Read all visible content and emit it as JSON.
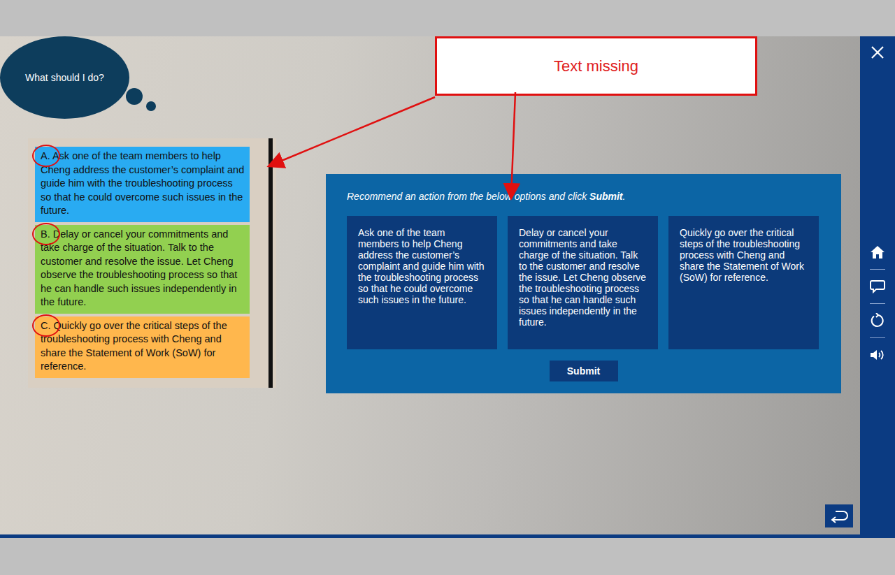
{
  "thought_bubble": {
    "text": "What should I do?"
  },
  "annotation_panel": {
    "options": [
      {
        "letter": "A.",
        "text": "Ask one of the team members  to help Cheng address the customer’s complaint and guide him with the troubleshooting process so that he could overcome such issues in the future.",
        "color": "#29abf2",
        "circled": true
      },
      {
        "letter": "B.",
        "text": "Delay or cancel your commitments and take charge of the situation. Talk to the customer and resolve the issue.  Let Cheng observe the troubleshooting process so that he can handle such issues independently in the future.",
        "color": "#92d050",
        "circled": true
      },
      {
        "letter": "C.",
        "text": "Quickly go over the critical steps of the troubleshooting process with Cheng and share the Statement of Work (SoW) for reference.",
        "color": "#ffb74d",
        "circled": true
      }
    ]
  },
  "callout": {
    "text": "Text missing"
  },
  "question": {
    "instruction": "Recommend an action from the below options and click ",
    "emphasis": "Submit",
    "ending": ".",
    "options": [
      {
        "text": "Ask one of the team members to help Cheng address the customer’s complaint and guide him with the troubleshooting process so that he could overcome such issues in the future.",
        "selected": false
      },
      {
        "text": "Delay or cancel your commitments and take charge of the situation. Talk to the customer and resolve the issue. Let Cheng observe the troubleshooting process so that he can handle such issues independently in the future.",
        "selected": false
      },
      {
        "text": "Quickly go over the critical steps of the troubleshooting process with Cheng and share the Statement of Work (SoW) for reference.",
        "selected": false
      }
    ],
    "submit": "Submit"
  }
}
